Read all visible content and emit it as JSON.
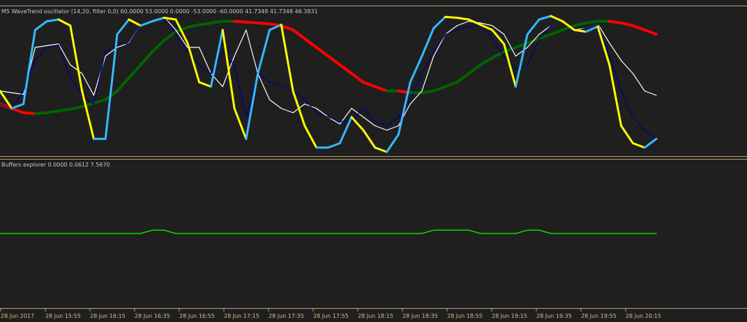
{
  "chart_data": [
    {
      "type": "line",
      "title": "M5 WaveTrend oscillator (14,20, filter 0,0) 60.0000 53.0000 0.0000 -53.0000 -60.0000 41.7348 41.7348 46.3831",
      "ylim": [
        -80,
        80
      ],
      "series": [
        {
          "color": "#33bbff",
          "alt_color": "#ffff00",
          "values": [
            -10,
            -30,
            -25,
            60,
            70,
            72,
            65,
            -10,
            -65,
            -65,
            55,
            72,
            65,
            70,
            74,
            72,
            45,
            0,
            -5,
            60,
            -30,
            -65,
            10,
            60,
            66,
            -10,
            -50,
            -75,
            -75,
            -70,
            -40,
            -55,
            -75,
            -80,
            -60,
            0,
            30,
            62,
            75,
            74,
            72,
            66,
            60,
            44,
            -5,
            55,
            72,
            76,
            70,
            60,
            58,
            64,
            20,
            -50,
            -70,
            -75,
            -65
          ]
        },
        {
          "color": "#00008b",
          "values": [
            -25,
            -30,
            -10,
            25,
            40,
            43,
            5,
            -15,
            -25,
            35,
            45,
            44,
            65,
            70,
            75,
            55,
            35,
            20,
            10,
            35,
            20,
            -40,
            10,
            0,
            -5,
            -10,
            -20,
            -35,
            -40,
            -45,
            -45,
            -30,
            -45,
            -50,
            -40,
            -20,
            10,
            35,
            55,
            60,
            64,
            66,
            50,
            30,
            15,
            20,
            50,
            65,
            70,
            58,
            62,
            67,
            30,
            -10,
            -40,
            -55,
            -65
          ]
        },
        {
          "color": "#ffffff",
          "values": [
            -10,
            -12,
            -14,
            40,
            42,
            44,
            20,
            10,
            -15,
            30,
            40,
            45,
            65,
            70,
            75,
            60,
            40,
            40,
            10,
            -5,
            30,
            60,
            10,
            -20,
            -30,
            -35,
            -25,
            -30,
            -40,
            -48,
            -30,
            -40,
            -50,
            -55,
            -50,
            -25,
            -10,
            30,
            55,
            65,
            70,
            68,
            65,
            55,
            30,
            40,
            55,
            65,
            70,
            60,
            62,
            67,
            45,
            25,
            10,
            -10,
            -15
          ]
        },
        {
          "color_up": "#006400",
          "color_down": "#ff0000",
          "values": [
            -25,
            -30,
            -35,
            -36,
            -35,
            -33,
            -31,
            -28,
            -24,
            -20,
            -10,
            5,
            20,
            35,
            48,
            58,
            63,
            66,
            68,
            70,
            70,
            69,
            68,
            67,
            65,
            60,
            50,
            40,
            30,
            20,
            10,
            0,
            -5,
            -10,
            -10,
            -12,
            -12,
            -10,
            -5,
            0,
            10,
            20,
            28,
            35,
            40,
            45,
            50,
            55,
            60,
            65,
            68,
            70,
            70,
            68,
            65,
            60,
            55
          ]
        }
      ]
    },
    {
      "type": "line",
      "title": "Buffers explorer 0.0000 0.0612 7.5670",
      "ylim": [
        -10,
        10
      ],
      "series": [
        {
          "color": "#00dd00",
          "values": [
            0,
            0,
            0,
            0,
            0,
            0,
            0,
            0,
            0,
            0,
            0,
            0,
            0,
            0.5,
            0.5,
            0,
            0,
            0,
            0,
            0,
            0,
            0,
            0,
            0,
            0,
            0,
            0,
            0,
            0,
            0,
            0,
            0,
            0,
            0,
            0,
            0,
            0,
            0.5,
            0.5,
            0.5,
            0.5,
            0,
            0,
            0,
            0,
            0.5,
            0.5,
            0,
            0,
            0,
            0,
            0,
            0,
            0,
            0,
            0,
            0
          ]
        }
      ]
    }
  ],
  "x_axis": {
    "tick_labels": [
      "28 Jun 2017",
      "28 Jun 15:55",
      "28 Jun 16:15",
      "28 Jun 16:35",
      "28 Jun 16:55",
      "28 Jun 17:15",
      "28 Jun 17:35",
      "28 Jun 17:55",
      "28 Jun 18:15",
      "28 Jun 18:35",
      "28 Jun 18:55",
      "28 Jun 19:15",
      "28 Jun 19:35",
      "28 Jun 19:55",
      "28 Jun 20:15"
    ]
  },
  "colors": {
    "background": "#1f1f1f",
    "separator": "#b8a070",
    "axis_text": "#d0c080"
  }
}
